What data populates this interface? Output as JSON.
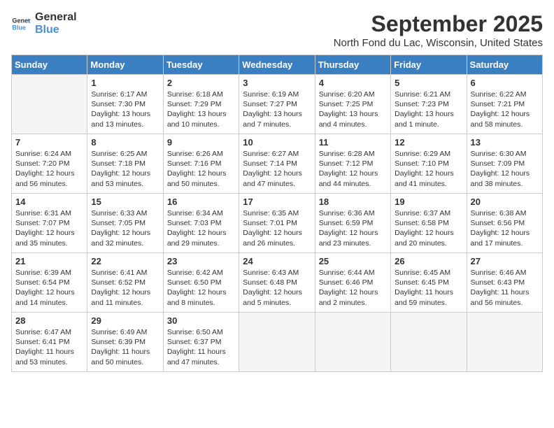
{
  "logo": {
    "general": "General",
    "blue": "Blue"
  },
  "title": "September 2025",
  "location": "North Fond du Lac, Wisconsin, United States",
  "weekdays": [
    "Sunday",
    "Monday",
    "Tuesday",
    "Wednesday",
    "Thursday",
    "Friday",
    "Saturday"
  ],
  "weeks": [
    [
      {
        "day": "",
        "lines": [],
        "empty": true
      },
      {
        "day": "1",
        "lines": [
          "Sunrise: 6:17 AM",
          "Sunset: 7:30 PM",
          "Daylight: 13 hours",
          "and 13 minutes."
        ]
      },
      {
        "day": "2",
        "lines": [
          "Sunrise: 6:18 AM",
          "Sunset: 7:29 PM",
          "Daylight: 13 hours",
          "and 10 minutes."
        ]
      },
      {
        "day": "3",
        "lines": [
          "Sunrise: 6:19 AM",
          "Sunset: 7:27 PM",
          "Daylight: 13 hours",
          "and 7 minutes."
        ]
      },
      {
        "day": "4",
        "lines": [
          "Sunrise: 6:20 AM",
          "Sunset: 7:25 PM",
          "Daylight: 13 hours",
          "and 4 minutes."
        ]
      },
      {
        "day": "5",
        "lines": [
          "Sunrise: 6:21 AM",
          "Sunset: 7:23 PM",
          "Daylight: 13 hours",
          "and 1 minute."
        ]
      },
      {
        "day": "6",
        "lines": [
          "Sunrise: 6:22 AM",
          "Sunset: 7:21 PM",
          "Daylight: 12 hours",
          "and 58 minutes."
        ]
      }
    ],
    [
      {
        "day": "7",
        "lines": [
          "Sunrise: 6:24 AM",
          "Sunset: 7:20 PM",
          "Daylight: 12 hours",
          "and 56 minutes."
        ]
      },
      {
        "day": "8",
        "lines": [
          "Sunrise: 6:25 AM",
          "Sunset: 7:18 PM",
          "Daylight: 12 hours",
          "and 53 minutes."
        ]
      },
      {
        "day": "9",
        "lines": [
          "Sunrise: 6:26 AM",
          "Sunset: 7:16 PM",
          "Daylight: 12 hours",
          "and 50 minutes."
        ]
      },
      {
        "day": "10",
        "lines": [
          "Sunrise: 6:27 AM",
          "Sunset: 7:14 PM",
          "Daylight: 12 hours",
          "and 47 minutes."
        ]
      },
      {
        "day": "11",
        "lines": [
          "Sunrise: 6:28 AM",
          "Sunset: 7:12 PM",
          "Daylight: 12 hours",
          "and 44 minutes."
        ]
      },
      {
        "day": "12",
        "lines": [
          "Sunrise: 6:29 AM",
          "Sunset: 7:10 PM",
          "Daylight: 12 hours",
          "and 41 minutes."
        ]
      },
      {
        "day": "13",
        "lines": [
          "Sunrise: 6:30 AM",
          "Sunset: 7:09 PM",
          "Daylight: 12 hours",
          "and 38 minutes."
        ]
      }
    ],
    [
      {
        "day": "14",
        "lines": [
          "Sunrise: 6:31 AM",
          "Sunset: 7:07 PM",
          "Daylight: 12 hours",
          "and 35 minutes."
        ]
      },
      {
        "day": "15",
        "lines": [
          "Sunrise: 6:33 AM",
          "Sunset: 7:05 PM",
          "Daylight: 12 hours",
          "and 32 minutes."
        ]
      },
      {
        "day": "16",
        "lines": [
          "Sunrise: 6:34 AM",
          "Sunset: 7:03 PM",
          "Daylight: 12 hours",
          "and 29 minutes."
        ]
      },
      {
        "day": "17",
        "lines": [
          "Sunrise: 6:35 AM",
          "Sunset: 7:01 PM",
          "Daylight: 12 hours",
          "and 26 minutes."
        ]
      },
      {
        "day": "18",
        "lines": [
          "Sunrise: 6:36 AM",
          "Sunset: 6:59 PM",
          "Daylight: 12 hours",
          "and 23 minutes."
        ]
      },
      {
        "day": "19",
        "lines": [
          "Sunrise: 6:37 AM",
          "Sunset: 6:58 PM",
          "Daylight: 12 hours",
          "and 20 minutes."
        ]
      },
      {
        "day": "20",
        "lines": [
          "Sunrise: 6:38 AM",
          "Sunset: 6:56 PM",
          "Daylight: 12 hours",
          "and 17 minutes."
        ]
      }
    ],
    [
      {
        "day": "21",
        "lines": [
          "Sunrise: 6:39 AM",
          "Sunset: 6:54 PM",
          "Daylight: 12 hours",
          "and 14 minutes."
        ]
      },
      {
        "day": "22",
        "lines": [
          "Sunrise: 6:41 AM",
          "Sunset: 6:52 PM",
          "Daylight: 12 hours",
          "and 11 minutes."
        ]
      },
      {
        "day": "23",
        "lines": [
          "Sunrise: 6:42 AM",
          "Sunset: 6:50 PM",
          "Daylight: 12 hours",
          "and 8 minutes."
        ]
      },
      {
        "day": "24",
        "lines": [
          "Sunrise: 6:43 AM",
          "Sunset: 6:48 PM",
          "Daylight: 12 hours",
          "and 5 minutes."
        ]
      },
      {
        "day": "25",
        "lines": [
          "Sunrise: 6:44 AM",
          "Sunset: 6:46 PM",
          "Daylight: 12 hours",
          "and 2 minutes."
        ]
      },
      {
        "day": "26",
        "lines": [
          "Sunrise: 6:45 AM",
          "Sunset: 6:45 PM",
          "Daylight: 11 hours",
          "and 59 minutes."
        ]
      },
      {
        "day": "27",
        "lines": [
          "Sunrise: 6:46 AM",
          "Sunset: 6:43 PM",
          "Daylight: 11 hours",
          "and 56 minutes."
        ]
      }
    ],
    [
      {
        "day": "28",
        "lines": [
          "Sunrise: 6:47 AM",
          "Sunset: 6:41 PM",
          "Daylight: 11 hours",
          "and 53 minutes."
        ]
      },
      {
        "day": "29",
        "lines": [
          "Sunrise: 6:49 AM",
          "Sunset: 6:39 PM",
          "Daylight: 11 hours",
          "and 50 minutes."
        ]
      },
      {
        "day": "30",
        "lines": [
          "Sunrise: 6:50 AM",
          "Sunset: 6:37 PM",
          "Daylight: 11 hours",
          "and 47 minutes."
        ]
      },
      {
        "day": "",
        "lines": [],
        "empty": true
      },
      {
        "day": "",
        "lines": [],
        "empty": true
      },
      {
        "day": "",
        "lines": [],
        "empty": true
      },
      {
        "day": "",
        "lines": [],
        "empty": true
      }
    ]
  ]
}
